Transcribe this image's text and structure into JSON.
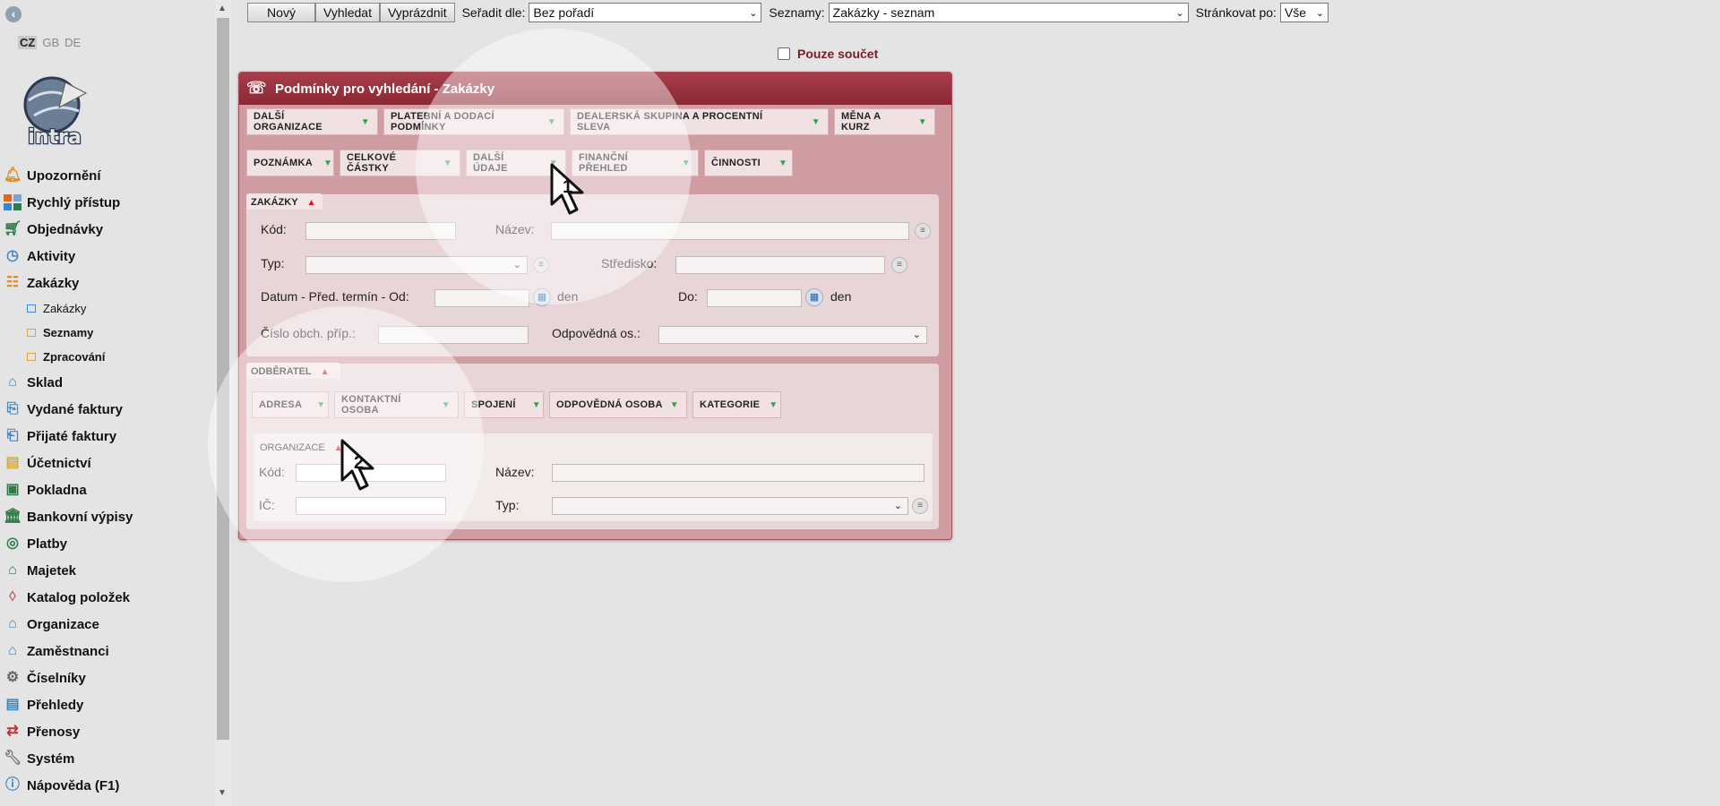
{
  "languages": [
    "CZ",
    "GB",
    "DE"
  ],
  "logo_text": "intra",
  "sidebar": {
    "items": [
      {
        "label": "Upozornění",
        "icon": "bell-icon"
      },
      {
        "label": "Rychlý přístup",
        "icon": "tiles-icon"
      },
      {
        "label": "Objednávky",
        "icon": "cart-icon"
      },
      {
        "label": "Aktivity",
        "icon": "clock-icon"
      },
      {
        "label": "Zakázky",
        "icon": "order-icon"
      },
      {
        "label": "Sklad",
        "icon": "warehouse-icon"
      },
      {
        "label": "Vydané faktury",
        "icon": "invoice-out-icon"
      },
      {
        "label": "Přijaté faktury",
        "icon": "invoice-in-icon"
      },
      {
        "label": "Účetnictví",
        "icon": "ledger-icon"
      },
      {
        "label": "Pokladna",
        "icon": "cash-register-icon"
      },
      {
        "label": "Bankovní výpisy",
        "icon": "bank-icon"
      },
      {
        "label": "Platby",
        "icon": "payment-icon"
      },
      {
        "label": "Majetek",
        "icon": "property-icon"
      },
      {
        "label": "Katalog položek",
        "icon": "tag-icon"
      },
      {
        "label": "Organizace",
        "icon": "organization-icon"
      },
      {
        "label": "Zaměstnanci",
        "icon": "employee-icon"
      },
      {
        "label": "Číselníky",
        "icon": "gear-icon"
      },
      {
        "label": "Přehledy",
        "icon": "list-icon"
      },
      {
        "label": "Přenosy",
        "icon": "transfer-icon"
      },
      {
        "label": "Systém",
        "icon": "wrench-icon"
      },
      {
        "label": "Nápověda (F1)",
        "icon": "help-icon"
      }
    ],
    "subitems": [
      "Zakázky",
      "Seznamy",
      "Zpracování"
    ]
  },
  "toolbar": {
    "new_label": "Nový",
    "search_label": "Vyhledat",
    "clear_label": "Vyprázdnit",
    "sort_label": "Seřadit dle:",
    "sort_value": "Bez pořadí",
    "lists_label": "Seznamy:",
    "lists_value": "Zakázky - seznam",
    "paging_label": "Stránkovat po:",
    "paging_value": "Vše"
  },
  "sum_only_label": "Pouze součet",
  "panel": {
    "title": "Podmínky pro vyhledání - Zakázky",
    "tabs_row1": [
      "DALŠÍ ORGANIZACE",
      "PLATEBNÍ A DODACÍ PODMÍNKY",
      "DEALERSKÁ SKUPINA A PROCENTNÍ SLEVA",
      "MĚNA A KURZ"
    ],
    "tabs_row2": [
      "POZNÁMKA",
      "CELKOVÉ ČÁSTKY",
      "DALŠÍ ÚDAJE",
      "FINANČNÍ PŘEHLED",
      "ČINNOSTI"
    ],
    "orders_section": {
      "label": "ZAKÁZKY",
      "code_label": "Kód:",
      "name_label": "Název:",
      "type_label": "Typ:",
      "center_label": "Středisko:",
      "date_label": "Datum - Před. termín - Od:",
      "to_label": "Do:",
      "day_unit": "den",
      "case_label": "Číslo obch. příp.:",
      "responsible_label": "Odpovědná os.:"
    },
    "customer_section": {
      "label": "ODBĚRATEL",
      "tabs": [
        "ADRESA",
        "KONTAKTNÍ OSOBA",
        "SPOJENÍ",
        "ODPOVĚDNÁ OSOBA",
        "KATEGORIE"
      ]
    },
    "organization_section": {
      "label": "ORGANIZACE",
      "code_label": "Kód:",
      "name_label": "Název:",
      "ic_label": "IČ:",
      "type_label": "Typ:"
    }
  },
  "annotations": [
    "1",
    "2"
  ],
  "colors": {
    "panel_header": "#8a2834",
    "panel_body": "#cf9ca1",
    "expand_arrow": "#2aa64a",
    "collapse_arrow": "#d11111",
    "sum_label": "#7a1c28"
  }
}
